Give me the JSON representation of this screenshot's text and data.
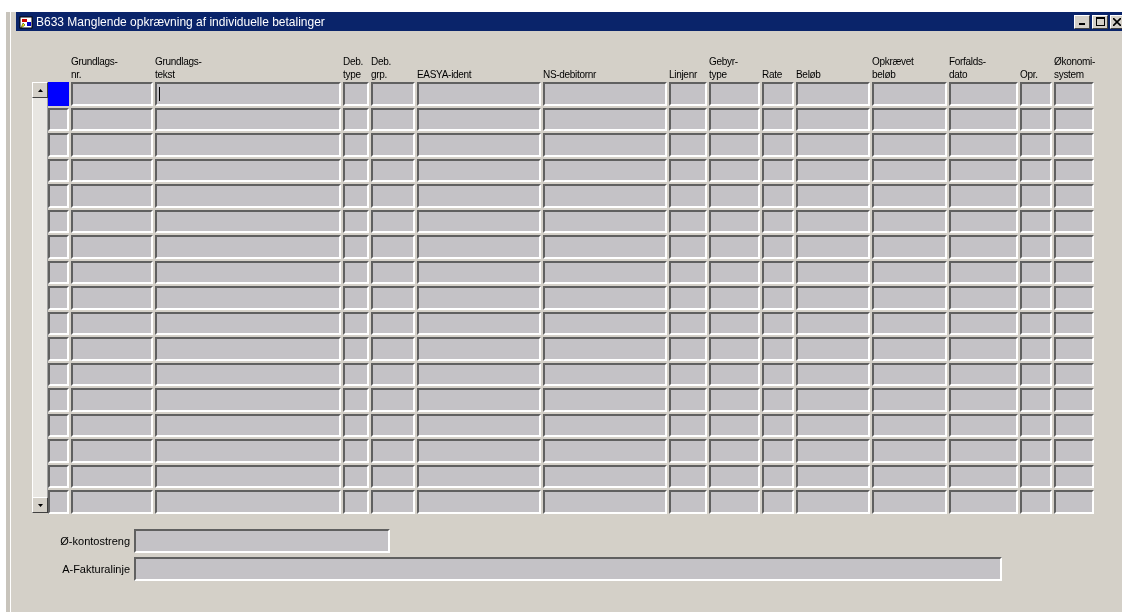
{
  "window": {
    "title": "B633 Manglende opkrævning af individuelle betalinger"
  },
  "table": {
    "columns": [
      "Grundlags-\nnr.",
      "Grundlags-\ntekst",
      "Deb.\ntype",
      "Deb.\ngrp.",
      "EASYA-ident",
      "NS-debitornr",
      "Linjenr",
      "Gebyr-\ntype",
      "Rate",
      "Beløb",
      "Opkrævet\nbeløb",
      "Forfalds-\ndato",
      "Opr.",
      "Økonomi-\nsystem"
    ],
    "rows": [
      {
        "selected": true
      },
      {
        "selected": false
      },
      {
        "selected": false
      },
      {
        "selected": false
      },
      {
        "selected": false
      },
      {
        "selected": false
      },
      {
        "selected": false
      },
      {
        "selected": false
      },
      {
        "selected": false
      },
      {
        "selected": false
      },
      {
        "selected": false
      },
      {
        "selected": false
      },
      {
        "selected": false
      },
      {
        "selected": false
      },
      {
        "selected": false
      },
      {
        "selected": false
      },
      {
        "selected": false
      }
    ]
  },
  "fields": [
    {
      "label": "Ø-kontostreng",
      "kind": "short"
    },
    {
      "label": "A-Fakturalinje",
      "kind": "long"
    }
  ]
}
